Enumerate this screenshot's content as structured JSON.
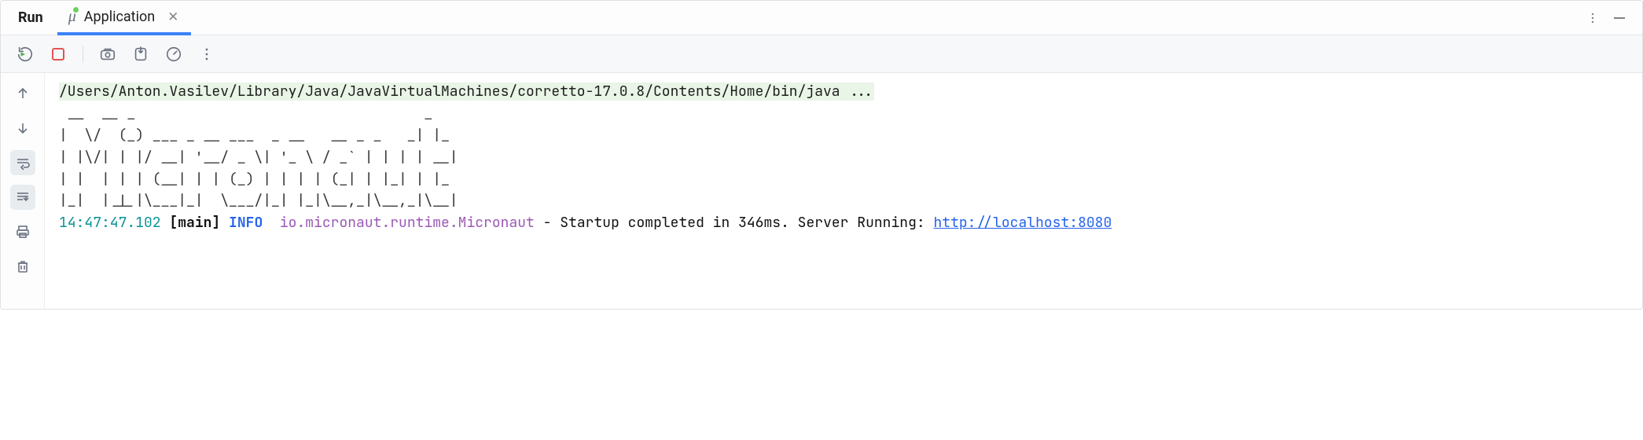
{
  "panel": {
    "title": "Run"
  },
  "tabs": [
    {
      "label": "Application",
      "icon": "mu-run"
    }
  ],
  "toolbar": {
    "buttons": {
      "rerun": "rerun-icon",
      "stop": "stop-icon",
      "snapshot": "camera-icon",
      "exit": "exit-icon",
      "profiler": "gauge-icon",
      "more": "more-icon"
    }
  },
  "gutter": {
    "buttons": {
      "up": "arrow-up-icon",
      "down": "arrow-down-icon",
      "soft_wrap": "softwrap-icon",
      "scroll_to_end": "scrollend-icon",
      "print": "print-icon",
      "clear": "trash-icon"
    }
  },
  "console": {
    "command_line": "/Users/Anton.Vasilev/Library/Java/JavaVirtualMachines/corretto-17.0.8/Contents/Home/bin/java ...",
    "banner": " __  __ _                                  _   \n|  \\/  (_) ___ _ __ ___  _ __   __ _ _   _| |_ \n| |\\/| | |/ __| '__/ _ \\| '_ \\ / _` | | | | __|\n| |  | | | (__| | | (_) | | | | (_| | |_| | |_ \n|_|  |_|_|\\___|_|  \\___/|_| |_|\\__,_|\\__,_|\\__|",
    "log": {
      "timestamp": "14:47:47.102",
      "thread": "[main]",
      "level": "INFO",
      "logger": "io.micronaut.runtime.Micronaut",
      "sep": " - ",
      "message": "Startup completed in 346ms. Server Running: ",
      "url": "http://localhost:8080"
    }
  }
}
